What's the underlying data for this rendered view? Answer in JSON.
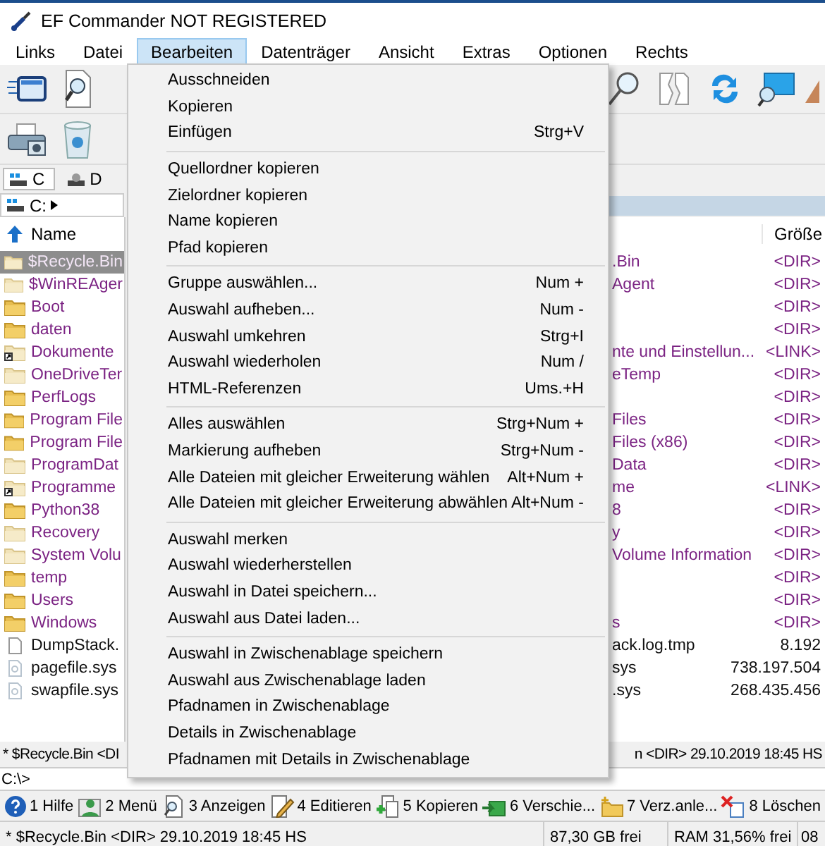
{
  "window": {
    "title": "EF Commander NOT REGISTERED"
  },
  "menu_bar": [
    {
      "label": "Links",
      "selected": false
    },
    {
      "label": "Datei",
      "selected": false
    },
    {
      "label": "Bearbeiten",
      "selected": true
    },
    {
      "label": "Datenträger",
      "selected": false
    },
    {
      "label": "Ansicht",
      "selected": false
    },
    {
      "label": "Extras",
      "selected": false
    },
    {
      "label": "Optionen",
      "selected": false
    },
    {
      "label": "Rechts",
      "selected": false
    }
  ],
  "edit_menu": {
    "groups": [
      [
        {
          "label": "Ausschneiden"
        },
        {
          "label": "Kopieren"
        },
        {
          "label": "Einfügen",
          "shortcut": "Strg+V"
        }
      ],
      [
        {
          "label": "Quellordner kopieren"
        },
        {
          "label": "Zielordner kopieren"
        },
        {
          "label": "Name kopieren"
        },
        {
          "label": "Pfad kopieren"
        }
      ],
      [
        {
          "label": "Gruppe auswählen...",
          "shortcut": "Num +"
        },
        {
          "label": "Auswahl aufheben...",
          "shortcut": "Num -"
        },
        {
          "label": "Auswahl umkehren",
          "shortcut": "Strg+I"
        },
        {
          "label": "Auswahl wiederholen",
          "shortcut": "Num /"
        },
        {
          "label": "HTML-Referenzen",
          "shortcut": "Ums.+H"
        }
      ],
      [
        {
          "label": "Alles auswählen",
          "shortcut": "Strg+Num +"
        },
        {
          "label": "Markierung aufheben",
          "shortcut": "Strg+Num -"
        },
        {
          "label": "Alle Dateien mit gleicher Erweiterung wählen",
          "shortcut": "Alt+Num +"
        },
        {
          "label": "Alle Dateien mit gleicher Erweiterung abwählen",
          "shortcut": "Alt+Num -"
        }
      ],
      [
        {
          "label": "Auswahl merken"
        },
        {
          "label": "Auswahl wiederherstellen"
        },
        {
          "label": "Auswahl in Datei speichern..."
        },
        {
          "label": "Auswahl aus Datei laden..."
        }
      ],
      [
        {
          "label": "Auswahl in Zwischenablage speichern"
        },
        {
          "label": "Auswahl aus Zwischenablage laden"
        },
        {
          "label": "Pfadnamen in Zwischenablage"
        },
        {
          "label": "Details in Zwischenablage"
        },
        {
          "label": "Pfadnamen mit Details in Zwischenablage"
        }
      ]
    ]
  },
  "drive_tabs": [
    {
      "label": "C",
      "selected": true
    },
    {
      "label": "D",
      "selected": false
    }
  ],
  "left_panel": {
    "path": "C:",
    "column": "Name",
    "files": [
      {
        "name": "$Recycle.Bin",
        "kind": "folder",
        "hidden": true,
        "selected": true
      },
      {
        "name": "$WinREAger",
        "kind": "folder",
        "hidden": true,
        "selected": false
      },
      {
        "name": "Boot",
        "kind": "folder",
        "hidden": false,
        "selected": false
      },
      {
        "name": "daten",
        "kind": "folder",
        "hidden": false,
        "selected": false
      },
      {
        "name": "Dokumente",
        "kind": "link",
        "hidden": true,
        "selected": false
      },
      {
        "name": "OneDriveTer",
        "kind": "folder",
        "hidden": true,
        "selected": false
      },
      {
        "name": "PerfLogs",
        "kind": "folder",
        "hidden": false,
        "selected": false
      },
      {
        "name": "Program File",
        "kind": "folder",
        "hidden": false,
        "selected": false
      },
      {
        "name": "Program File",
        "kind": "folder",
        "hidden": false,
        "selected": false
      },
      {
        "name": "ProgramDat",
        "kind": "folder",
        "hidden": true,
        "selected": false
      },
      {
        "name": "Programme",
        "kind": "link",
        "hidden": true,
        "selected": false
      },
      {
        "name": "Python38",
        "kind": "folder",
        "hidden": false,
        "selected": false
      },
      {
        "name": "Recovery",
        "kind": "folder",
        "hidden": true,
        "selected": false
      },
      {
        "name": "System Volu",
        "kind": "folder",
        "hidden": true,
        "selected": false
      },
      {
        "name": "temp",
        "kind": "folder",
        "hidden": false,
        "selected": false
      },
      {
        "name": "Users",
        "kind": "folder",
        "hidden": false,
        "selected": false
      },
      {
        "name": "Windows",
        "kind": "folder",
        "hidden": false,
        "selected": false
      },
      {
        "name": "DumpStack.",
        "kind": "file",
        "hidden": false,
        "selected": false
      },
      {
        "name": "pagefile.sys",
        "kind": "file",
        "hidden": true,
        "selected": false
      },
      {
        "name": "swapfile.sys",
        "kind": "file",
        "hidden": true,
        "selected": false
      }
    ],
    "status": "* $Recycle.Bin <DI"
  },
  "right_panel": {
    "column": "Größe",
    "files": [
      {
        "name": ".Bin",
        "size": "<DIR>",
        "kind": "folder"
      },
      {
        "name": "Agent",
        "size": "<DIR>",
        "kind": "folder"
      },
      {
        "size": "<DIR>",
        "kind": "folder"
      },
      {
        "size": "<DIR>",
        "kind": "folder"
      },
      {
        "name": "nte und Einstellun...",
        "size": "<LINK>",
        "kind": "link"
      },
      {
        "name": "eTemp",
        "size": "<DIR>",
        "kind": "folder"
      },
      {
        "size": "<DIR>",
        "kind": "folder"
      },
      {
        "name": "Files",
        "size": "<DIR>",
        "kind": "folder"
      },
      {
        "name": "Files (x86)",
        "size": "<DIR>",
        "kind": "folder"
      },
      {
        "name": "Data",
        "size": "<DIR>",
        "kind": "folder"
      },
      {
        "name": "me",
        "size": "<LINK>",
        "kind": "link"
      },
      {
        "name": "8",
        "size": "<DIR>",
        "kind": "folder"
      },
      {
        "name": "y",
        "size": "<DIR>",
        "kind": "folder"
      },
      {
        "name": "Volume Information",
        "size": "<DIR>",
        "kind": "folder"
      },
      {
        "size": "<DIR>",
        "kind": "folder"
      },
      {
        "size": "<DIR>",
        "kind": "folder"
      },
      {
        "name": "s",
        "size": "<DIR>",
        "kind": "folder"
      },
      {
        "name": "ack.log.tmp",
        "size": "8.192",
        "kind": "file"
      },
      {
        "name": "sys",
        "size": "738.197.504",
        "kind": "file"
      },
      {
        "name": ".sys",
        "size": "268.435.456",
        "kind": "file"
      }
    ],
    "status": "n  <DIR>  29.10.2019  18:45  HS"
  },
  "command_line": "C:\\>",
  "function_keys": [
    {
      "label": "1 Hilfe"
    },
    {
      "label": "2 Menü"
    },
    {
      "label": "3 Anzeigen"
    },
    {
      "label": "4 Editieren"
    },
    {
      "label": "5 Kopieren"
    },
    {
      "label": "6 Verschie..."
    },
    {
      "label": "7 Verz.anle..."
    },
    {
      "label": "8 Löschen"
    }
  ],
  "status_bar": {
    "file": "* $Recycle.Bin   <DIR>  29.10.2019  18:45  HS",
    "free_space": "87,30 GB frei",
    "ram": "RAM 31,56% frei",
    "field_4": "08"
  }
}
